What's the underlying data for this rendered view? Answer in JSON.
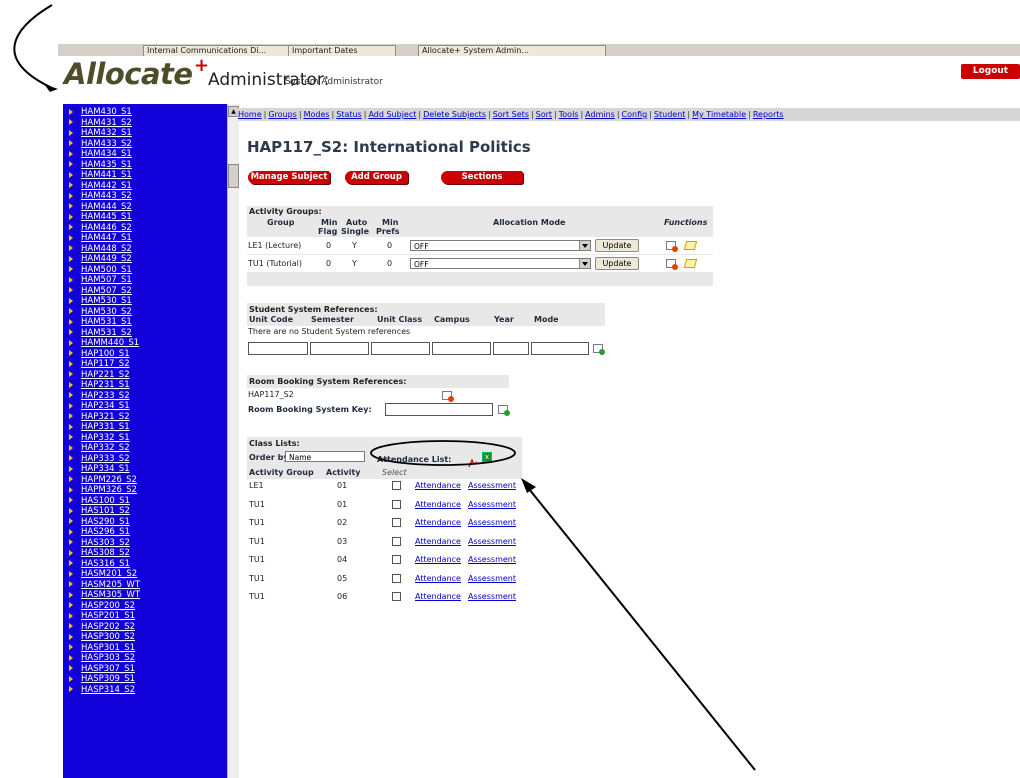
{
  "taskbar": {
    "tabs": [
      "Internal Communications Di...",
      "Important Dates",
      "Allocate+ System Admin..."
    ]
  },
  "header": {
    "logo": "Allocate",
    "logo_plus": "+",
    "title": "Administrator:",
    "subtitle": "System Administrator",
    "logout": "Logout"
  },
  "sidebar": {
    "items": [
      "HAM430_S1",
      "HAM431_S2",
      "HAM432_S1",
      "HAM433_S2",
      "HAM434_S1",
      "HAM435_S1",
      "HAM441_S1",
      "HAM442_S1",
      "HAM443_S2",
      "HAM444_S2",
      "HAM445_S1",
      "HAM446_S2",
      "HAM447_S1",
      "HAM448_S2",
      "HAM449_S2",
      "HAM500_S1",
      "HAM507_S1",
      "HAM507_S2",
      "HAM530_S1",
      "HAM530_S2",
      "HAM531_S1",
      "HAM531_S2",
      "HAMM440_S1",
      "HAP100_S1",
      "HAP117_S2",
      "HAP221_S2",
      "HAP231_S1",
      "HAP233_S2",
      "HAP234_S1",
      "HAP321_S2",
      "HAP331_S1",
      "HAP332_S1",
      "HAP332_S2",
      "HAP333_S2",
      "HAP334_S1",
      "HAPM226_S2",
      "HAPM326_S2",
      "HAS100_S1",
      "HAS101_S2",
      "HAS290_S1",
      "HAS296_S1",
      "HAS303_S2",
      "HAS308_S2",
      "HAS316_S1",
      "HASM201_S2",
      "HASM205_WT",
      "HASM305_WT",
      "HASP200_S2",
      "HASP201_S1",
      "HASP202_S2",
      "HASP300_S2",
      "HASP301_S1",
      "HASP303_S2",
      "HASP307_S1",
      "HASP309_S1",
      "HASP314_S2"
    ]
  },
  "nav": {
    "links": [
      "Home",
      "Groups",
      "Modes",
      "Status",
      "Add Subject",
      "Delete Subjects",
      "Sort Sets",
      "Sort",
      "Tools",
      "Admins",
      "Config",
      "Student",
      "My Timetable",
      "Reports"
    ]
  },
  "page": {
    "title": "HAP117_S2: International Politics",
    "buttons": {
      "manage": "Manage Subject",
      "add_group": "Add Group",
      "sections": "Sections"
    }
  },
  "activity_groups": {
    "heading": "Activity Groups:",
    "columns": {
      "group": "Group",
      "min": "Min",
      "flag": "Flag",
      "auto": "Auto",
      "single": "Single",
      "min2": "Min",
      "prefs": "Prefs",
      "mode": "Allocation Mode",
      "functions": "Functions"
    },
    "rows": [
      {
        "group": "LE1 (Lecture)",
        "flag": "0",
        "single": "Y",
        "prefs": "0",
        "mode": "OFF",
        "update": "Update"
      },
      {
        "group": "TU1 (Tutorial)",
        "flag": "0",
        "single": "Y",
        "prefs": "0",
        "mode": "OFF",
        "update": "Update"
      }
    ]
  },
  "student_refs": {
    "heading": "Student System References:",
    "columns": [
      "Unit Code",
      "Semester",
      "Unit Class",
      "Campus",
      "Year",
      "Mode"
    ],
    "empty": "There are no Student System references"
  },
  "room_refs": {
    "heading": "Room Booking System References:",
    "code": "HAP117_S2",
    "key_label": "Room Booking System Key:"
  },
  "class_lists": {
    "heading": "Class Lists:",
    "order_label": "Order by:",
    "order_value": "Name",
    "attendance_list": "Attendance List:",
    "columns": {
      "group": "Activity Group",
      "activity": "Activity",
      "select": "Select"
    },
    "rows": [
      {
        "group": "LE1",
        "activity": "01"
      },
      {
        "group": "TU1",
        "activity": "01"
      },
      {
        "group": "TU1",
        "activity": "02"
      },
      {
        "group": "TU1",
        "activity": "03"
      },
      {
        "group": "TU1",
        "activity": "04"
      },
      {
        "group": "TU1",
        "activity": "05"
      },
      {
        "group": "TU1",
        "activity": "06"
      }
    ],
    "attendance": "Attendance",
    "assessment": "Assessment"
  }
}
